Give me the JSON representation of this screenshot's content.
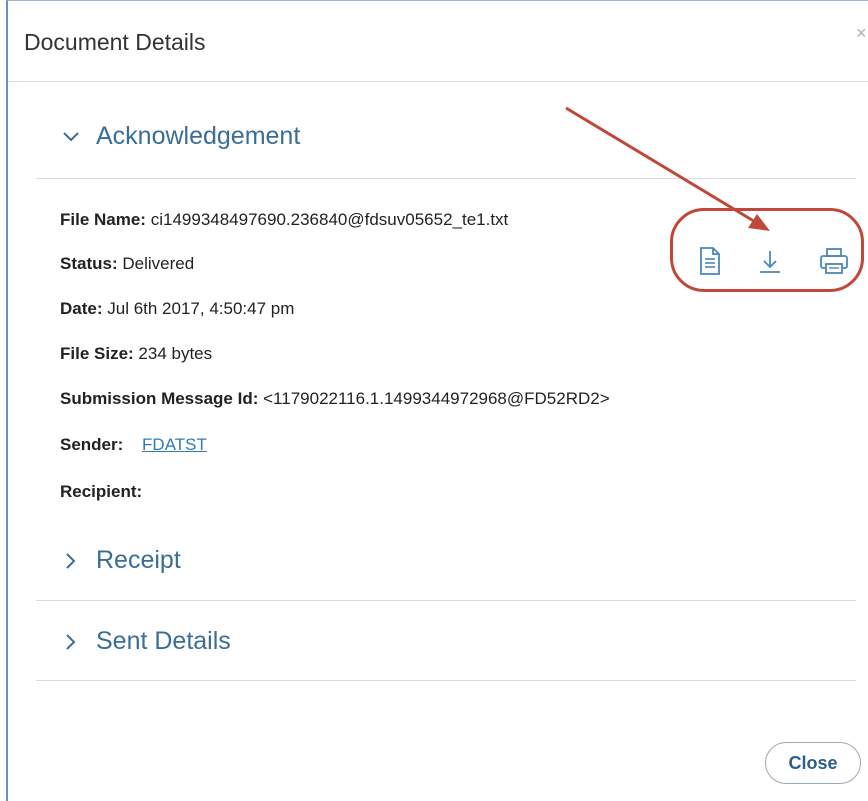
{
  "dialog": {
    "title": "Document Details",
    "close_x": "×"
  },
  "acknowledgement": {
    "label": "Acknowledgement",
    "fields": {
      "file_name_label": "File Name:",
      "file_name_value": "ci1499348497690.236840@fdsuv05652_te1.txt",
      "status_label": "Status:",
      "status_value": "Delivered",
      "date_label": "Date:",
      "date_value": "Jul 6th 2017, 4:50:47 pm",
      "file_size_label": "File Size:",
      "file_size_value": "234 bytes",
      "submission_label": "Submission Message Id:",
      "submission_value": "<1179022116.1.1499344972968@FD52RD2>",
      "sender_label": "Sender:",
      "sender_value": "FDATST",
      "recipient_label": "Recipient:",
      "recipient_value": ""
    },
    "actions": [
      "document-icon",
      "download-icon",
      "print-icon"
    ]
  },
  "receipt": {
    "label": "Receipt"
  },
  "sent_details": {
    "label": "Sent Details"
  },
  "footer": {
    "close_label": "Close"
  },
  "colors": {
    "accent": "#3a6e96",
    "link": "#2e7bb6",
    "annotation": "#c0473a",
    "icon": "#4a87b8"
  }
}
